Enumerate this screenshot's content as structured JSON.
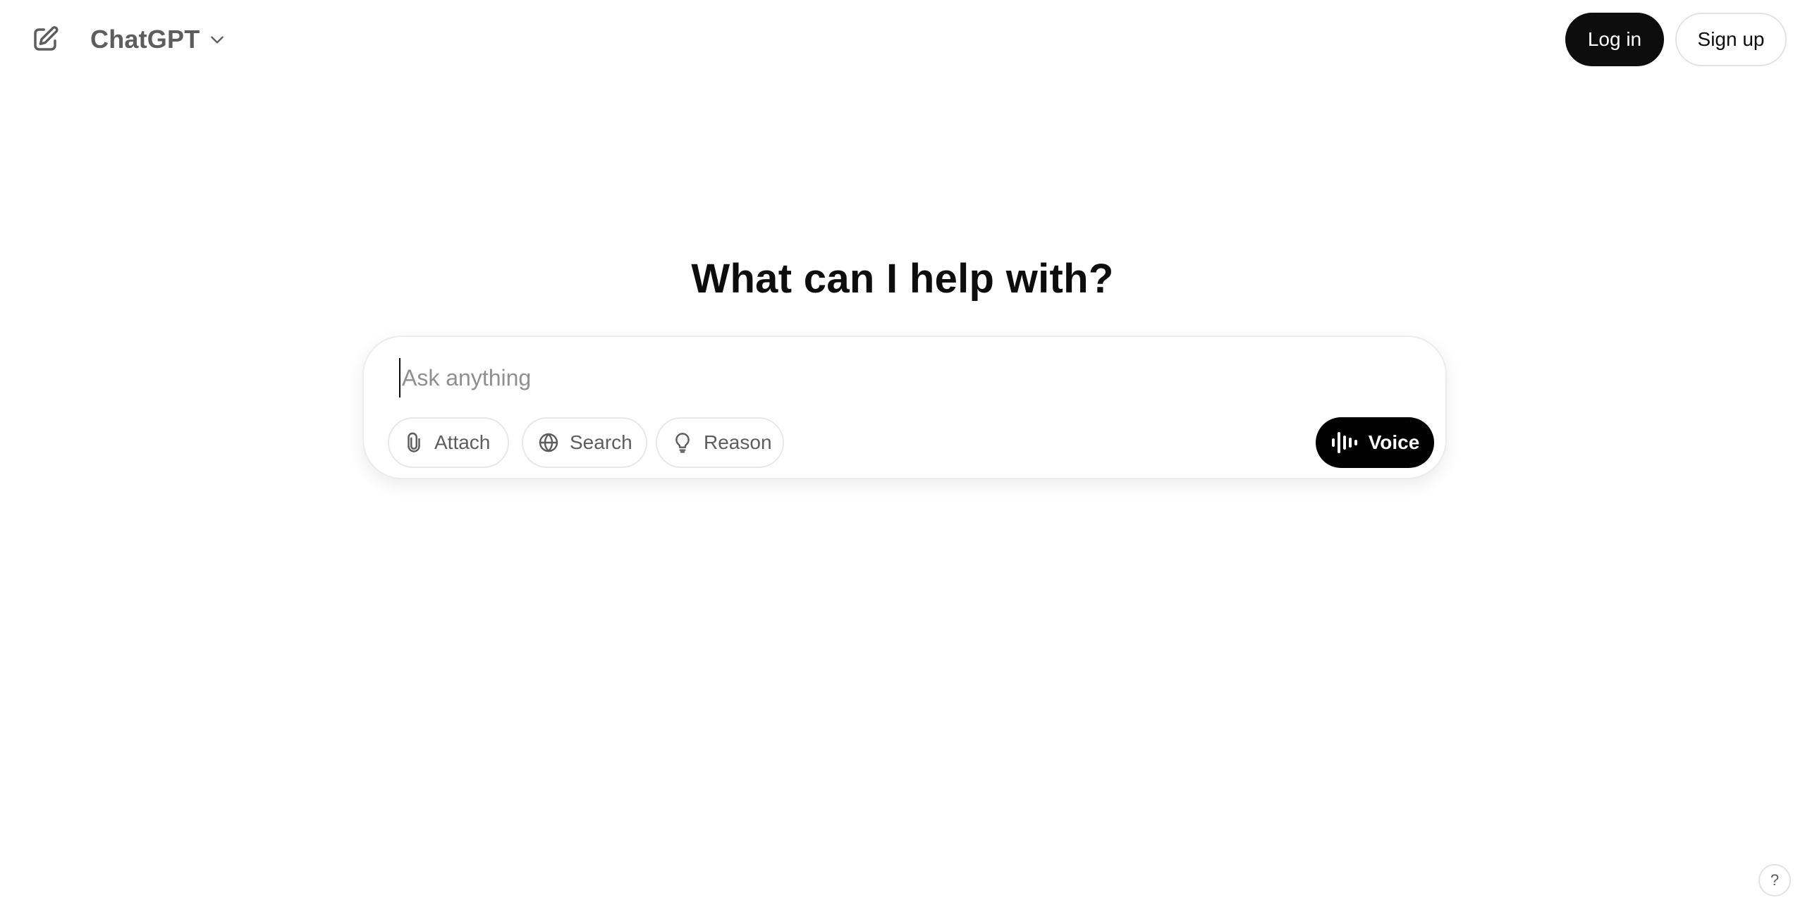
{
  "header": {
    "new_chat_icon": "pencil-square-icon",
    "model_name": "ChatGPT",
    "model_chevron_icon": "chevron-down-icon",
    "login_label": "Log in",
    "signup_label": "Sign up"
  },
  "main": {
    "headline": "What can I help with?",
    "composer": {
      "placeholder": "Ask anything",
      "value": "",
      "tools": [
        {
          "label": "Attach",
          "icon": "paperclip-icon"
        },
        {
          "label": "Search",
          "icon": "globe-icon"
        },
        {
          "label": "Reason",
          "icon": "lightbulb-icon"
        }
      ],
      "voice_label": "Voice",
      "voice_icon": "waveform-icon"
    }
  },
  "footer": {
    "help_label": "?"
  },
  "colors": {
    "primary_button": "#0d0d0d",
    "muted_text": "#5d5d5d",
    "placeholder_text": "#8f8f8f",
    "border": "#e3e3e3",
    "background": "#ffffff"
  }
}
